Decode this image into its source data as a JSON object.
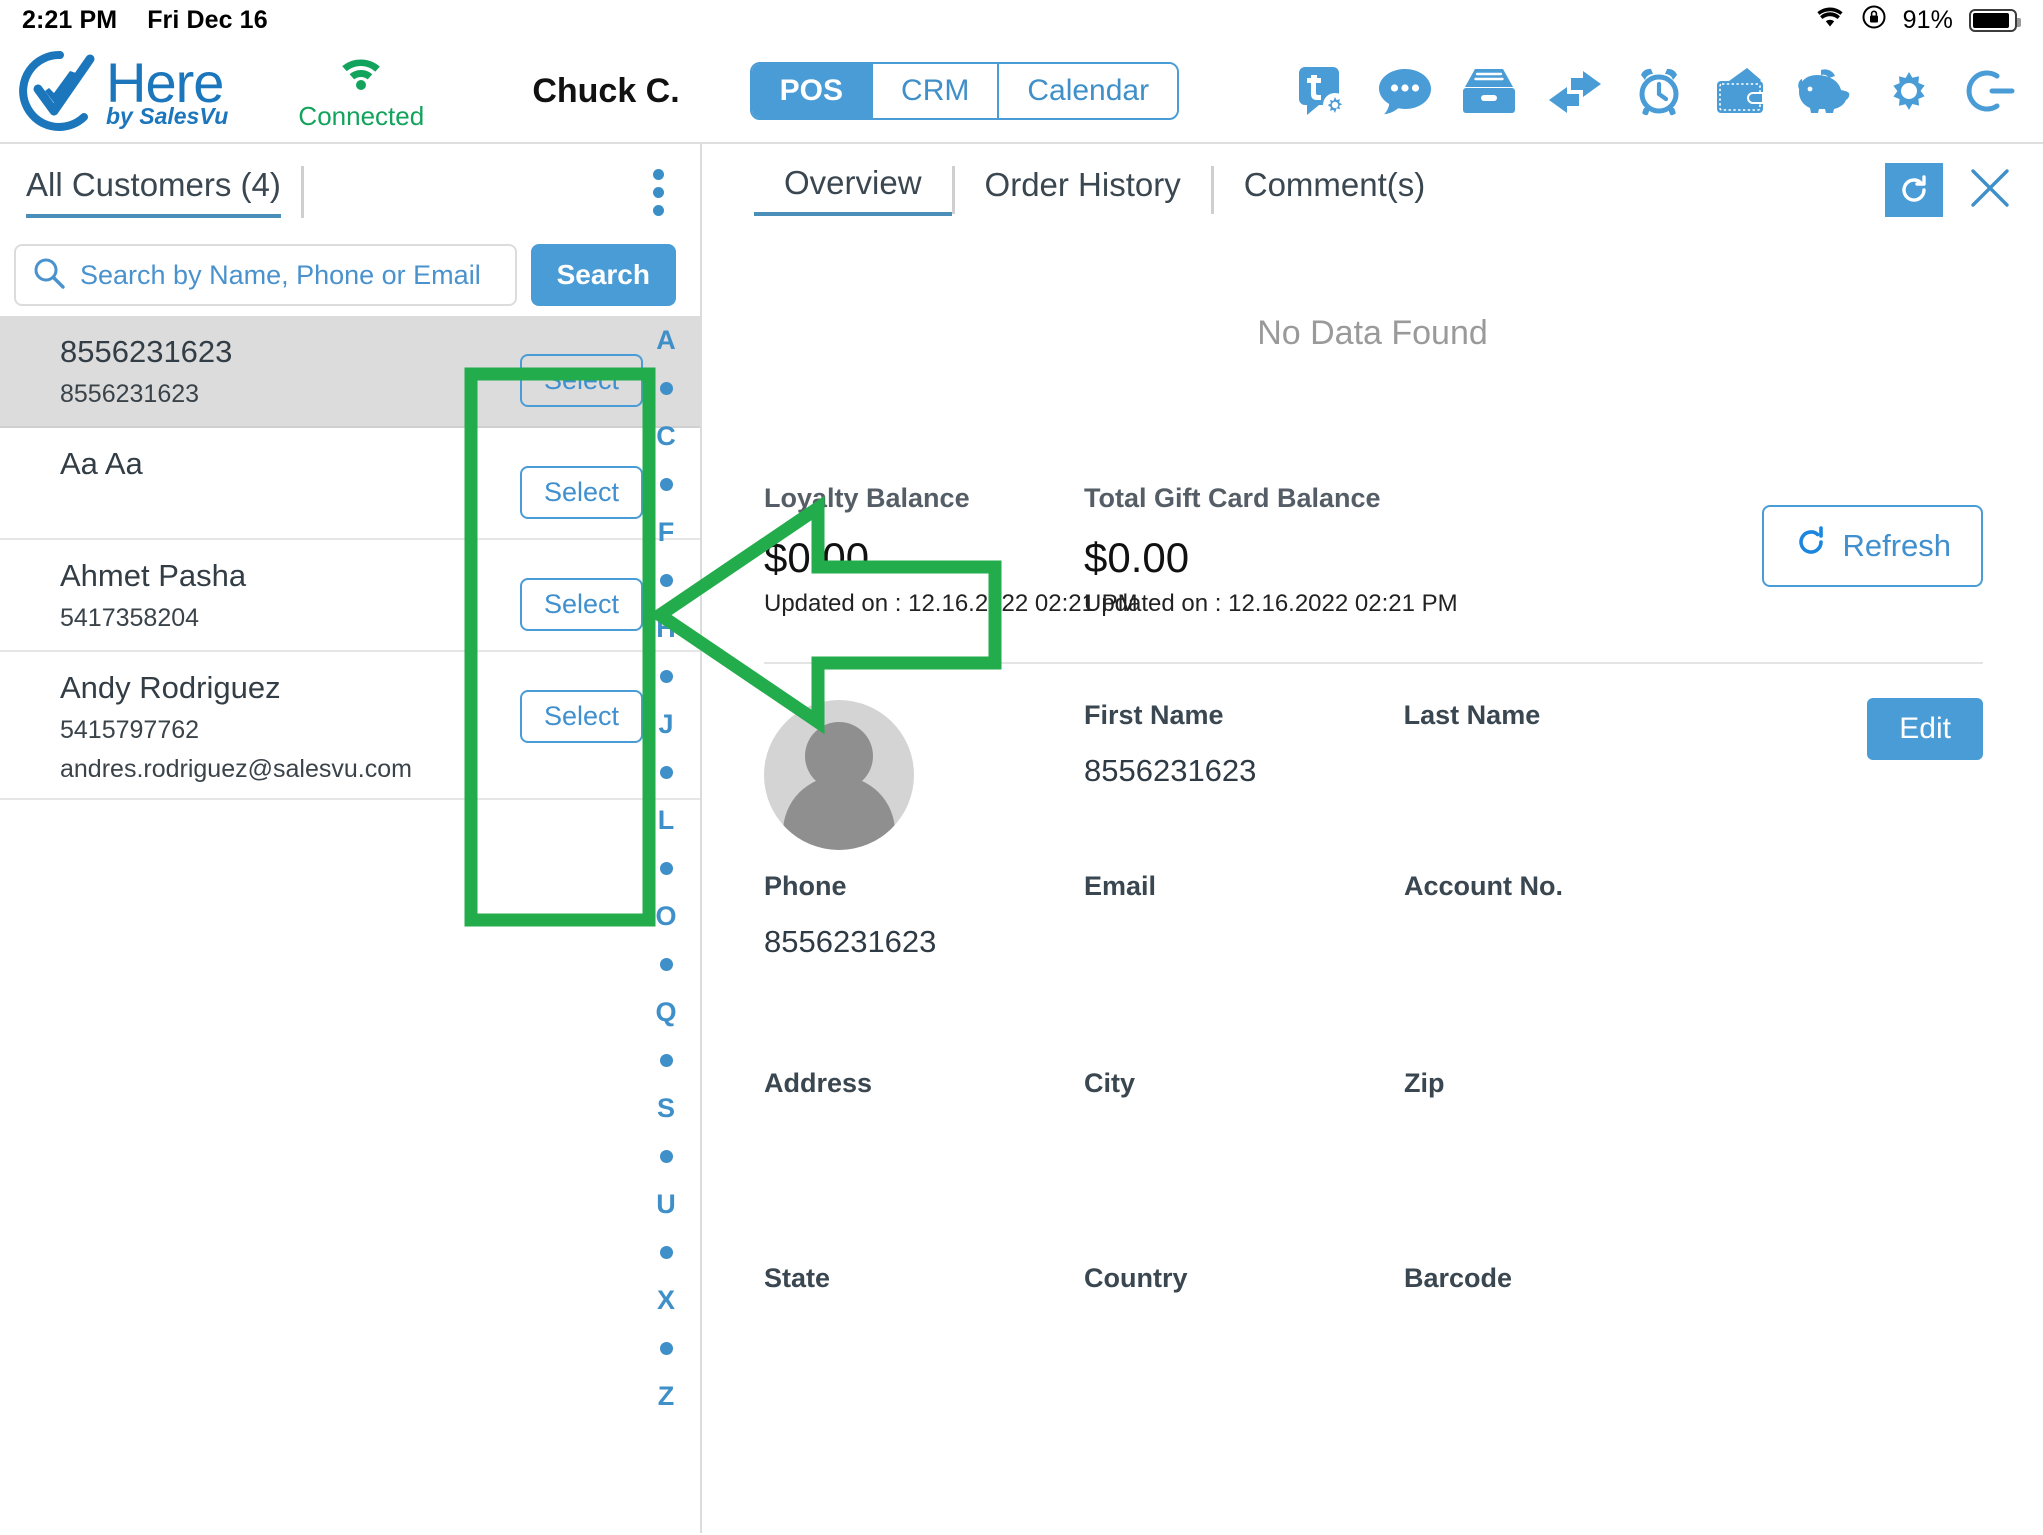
{
  "status_bar": {
    "time": "2:21 PM",
    "date": "Fri Dec 16",
    "battery_percent": "91%",
    "wifi_icon": "wifi-icon",
    "orientation_lock_icon": "rotation-lock-icon",
    "battery_icon": "battery-icon"
  },
  "header": {
    "logo_title": "Here",
    "logo_subtitle": "by SalesVu",
    "connection_status": "Connected",
    "connection_icon": "wifi-signal-icon",
    "user_name": "Chuck C.",
    "mode_tabs": [
      {
        "label": "POS",
        "active": true
      },
      {
        "label": "CRM",
        "active": false
      },
      {
        "label": "Calendar",
        "active": false
      }
    ],
    "icons": [
      {
        "name": "ticket-settings-icon"
      },
      {
        "name": "chat-bubble-icon"
      },
      {
        "name": "file-drawer-icon"
      },
      {
        "name": "transfer-arrows-icon"
      },
      {
        "name": "alarm-clock-icon"
      },
      {
        "name": "wallet-icon"
      },
      {
        "name": "piggy-bank-icon"
      },
      {
        "name": "gear-icon"
      },
      {
        "name": "logout-icon"
      }
    ]
  },
  "customer_list": {
    "title": "All Customers (4)",
    "kebab_icon": "more-options-icon",
    "search": {
      "placeholder": "Search by Name, Phone or Email",
      "value": "",
      "icon": "search-icon",
      "button_label": "Search"
    },
    "select_label": "Select",
    "rows": [
      {
        "name": "8556231623",
        "line2": "8556231623",
        "line3": "",
        "selected": true
      },
      {
        "name": "Aa Aa",
        "line2": "",
        "line3": "",
        "selected": false
      },
      {
        "name": "Ahmet Pasha",
        "line2": "5417358204",
        "line3": "",
        "selected": false
      },
      {
        "name": "Andy Rodriguez",
        "line2": "5415797762",
        "line3": "andres.rodriguez@salesvu.com",
        "selected": false
      }
    ],
    "alpha_index": [
      "A",
      "•",
      "C",
      "•",
      "F",
      "•",
      "H",
      "•",
      "J",
      "•",
      "L",
      "•",
      "O",
      "•",
      "Q",
      "•",
      "S",
      "•",
      "U",
      "•",
      "X",
      "•",
      "Z"
    ]
  },
  "detail": {
    "tabs": [
      {
        "label": "Overview",
        "active": true
      },
      {
        "label": "Order History",
        "active": false
      },
      {
        "label": "Comment(s)",
        "active": false
      }
    ],
    "refresh_tab_icon": "refresh-icon",
    "close_icon": "close-icon",
    "no_data_text": "No Data Found",
    "loyalty": {
      "label": "Loyalty Balance",
      "value": "$0.00",
      "updated": "Updated on : 12.16.2022 02:21 PM"
    },
    "gift_card": {
      "label": "Total Gift Card Balance",
      "value": "$0.00",
      "updated": "Updated on : 12.16.2022 02:21 PM"
    },
    "refresh_button": {
      "label": "Refresh",
      "icon": "refresh-circle-icon"
    },
    "avatar_icon": "user-avatar-placeholder",
    "edit_button_label": "Edit",
    "fields_row1": [
      {
        "label": "First Name",
        "value": "8556231623"
      },
      {
        "label": "Last Name",
        "value": ""
      }
    ],
    "fields_row2": [
      {
        "label": "Phone",
        "value": "8556231623"
      },
      {
        "label": "Email",
        "value": ""
      },
      {
        "label": "Account No.",
        "value": ""
      }
    ],
    "fields_row3": [
      {
        "label": "Address",
        "value": ""
      },
      {
        "label": "City",
        "value": ""
      },
      {
        "label": "Zip",
        "value": ""
      }
    ],
    "fields_row4": [
      {
        "label": "State",
        "value": ""
      },
      {
        "label": "Country",
        "value": ""
      },
      {
        "label": "Barcode",
        "value": ""
      }
    ]
  },
  "annotations": {
    "highlight_box_color": "#22ac4b",
    "arrow_color": "#22ac4b",
    "highlight_target": "select-buttons-column",
    "arrow_target": "loyalty-balance"
  },
  "colors": {
    "brand_blue": "#4a9cd6",
    "logo_blue": "#1b76bc",
    "connected_green": "#12a35c",
    "annotation_green": "#22ac4b",
    "selected_row_gray": "#dcdcdc"
  }
}
